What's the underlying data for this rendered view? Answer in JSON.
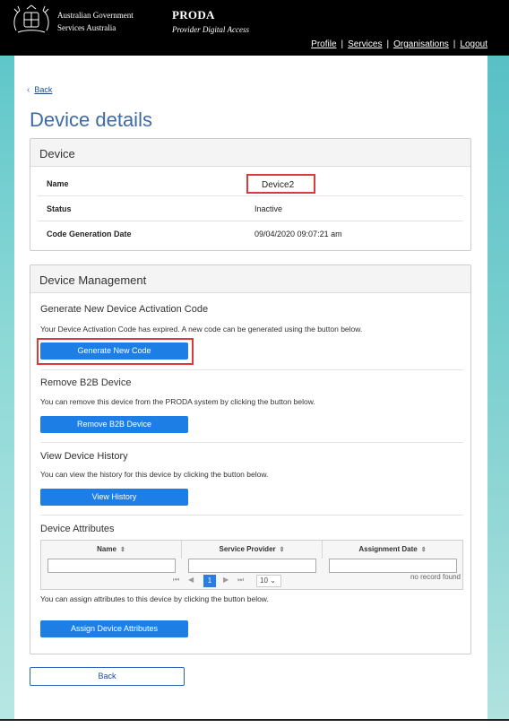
{
  "header": {
    "gov_line1": "Australian Government",
    "gov_line2": "Services Australia",
    "app_title": "PRODA",
    "app_subtitle": "Provider Digital Access",
    "nav": [
      "Profile",
      "Services",
      "Organisations",
      "Logout"
    ],
    "nav_separator": "|"
  },
  "back_top": {
    "chevron": "‹",
    "label": "Back"
  },
  "page_title": "Device details",
  "device_panel": {
    "heading": "Device",
    "rows": [
      {
        "label": "Name",
        "value": "Device2"
      },
      {
        "label": "Status",
        "value": "Inactive"
      },
      {
        "label": "Code Generation Date",
        "value": "09/04/2020 09:07:21 am"
      }
    ]
  },
  "management_panel": {
    "heading": "Device Management",
    "generate": {
      "title": "Generate New Device Activation Code",
      "text": "Your Device Activation Code has expired. A new code can be generated using the button below.",
      "button": "Generate New Code"
    },
    "remove": {
      "title": "Remove B2B Device",
      "text": "You can remove this device from the PRODA system by clicking the button below.",
      "button": "Remove B2B Device"
    },
    "history": {
      "title": "View Device History",
      "text": "You can view the history for this device by clicking the button below.",
      "button": "View History"
    },
    "attributes": {
      "title": "Device Attributes",
      "columns": [
        "Name",
        "Service Provider",
        "Assignment Date"
      ],
      "sort_icon": "⇕",
      "pager": {
        "first": "⏮",
        "prev": "◀",
        "current": "1",
        "next": "▶",
        "last": "⏭",
        "page_size": "10"
      },
      "empty_text": "no record found",
      "text": "You can assign attributes to this device by clicking the button below.",
      "button": "Assign Device Attributes"
    }
  },
  "back_bottom": {
    "label": "Back"
  },
  "colors": {
    "primary": "#1d7fe6",
    "title_blue": "#3d6ba8",
    "highlight_red": "#d93a3a",
    "header_bg": "#000000"
  }
}
